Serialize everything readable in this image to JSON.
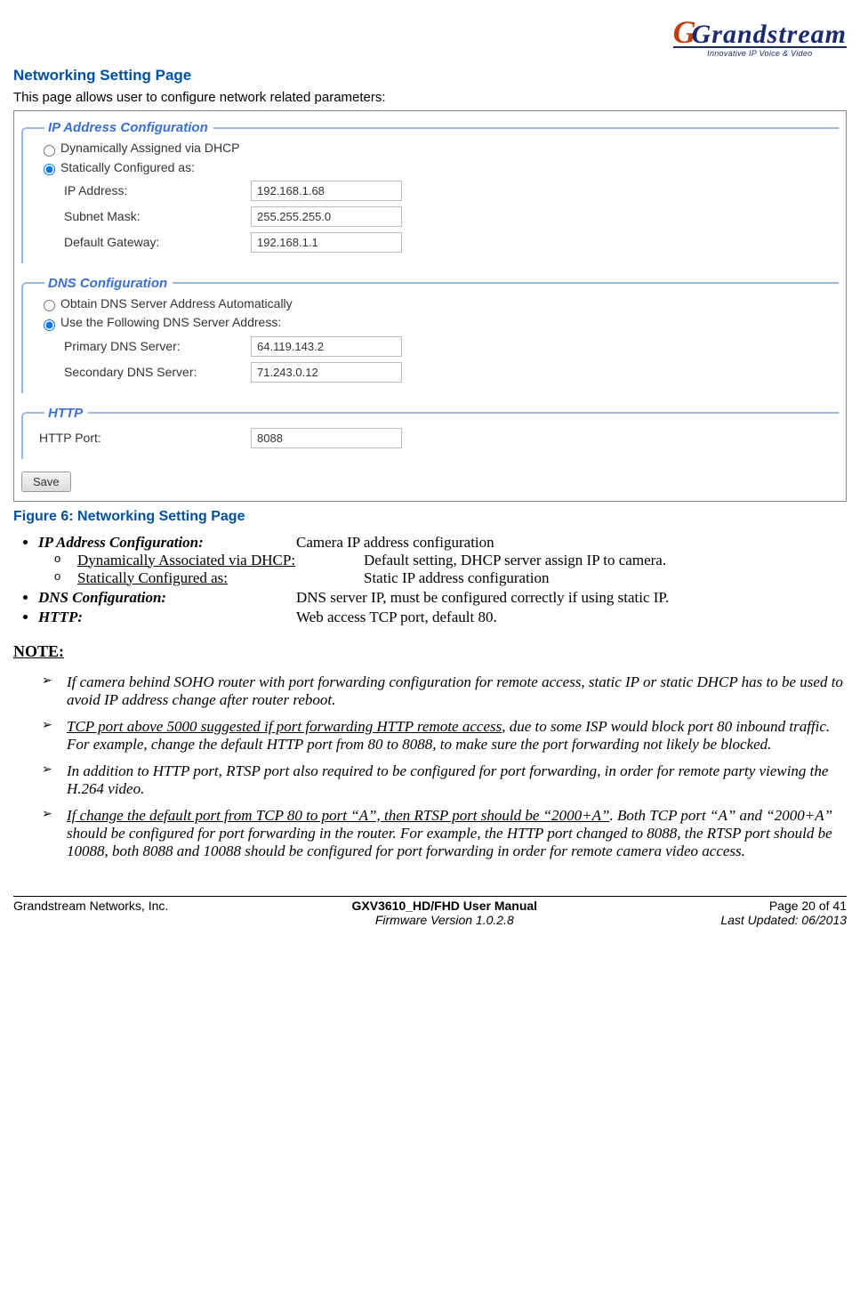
{
  "logo": {
    "main": "Grandstream",
    "sub": "Innovative IP Voice & Video"
  },
  "section": {
    "title": "Networking Setting Page",
    "intro": "This page allows user to configure network related parameters:"
  },
  "screenshot": {
    "ip": {
      "legend": "IP Address Configuration",
      "opt_dhcp": "Dynamically Assigned via DHCP",
      "opt_static": "Statically Configured as:",
      "ip_label": "IP Address:",
      "ip_value": "192.168.1.68",
      "mask_label": "Subnet Mask:",
      "mask_value": "255.255.255.0",
      "gw_label": "Default Gateway:",
      "gw_value": "192.168.1.1"
    },
    "dns": {
      "legend": "DNS Configuration",
      "opt_auto": "Obtain DNS Server Address Automatically",
      "opt_manual": "Use the Following DNS Server Address:",
      "primary_label": "Primary DNS Server:",
      "primary_value": "64.119.143.2",
      "secondary_label": "Secondary DNS Server:",
      "secondary_value": "71.243.0.12"
    },
    "http": {
      "legend": "HTTP",
      "port_label": "HTTP Port:",
      "port_value": "8088"
    },
    "save": "Save"
  },
  "figure_caption": "Figure 6:  Networking Setting Page",
  "config": {
    "ip_term": "IP Address Configuration:",
    "ip_desc": "Camera IP address configuration",
    "ip_sub1_label": "Dynamically Associated via DHCP:",
    "ip_sub1_desc": "Default setting, DHCP server assign IP to camera.",
    "ip_sub2_label": "Statically Configured as: ",
    "ip_sub2_desc": "Static IP address configuration",
    "dns_term": "DNS Configuration:",
    "dns_desc": "DNS server IP, must be configured correctly if using static IP.",
    "http_term": "HTTP:",
    "http_desc": "Web access TCP port, default 80."
  },
  "note": {
    "heading": "NOTE:",
    "n1": "If camera behind SOHO router with port forwarding configuration for remote access, static IP or static DHCP has to be used to avoid IP address change after router reboot.",
    "n2_u": "TCP port above 5000 suggested if port forwarding HTTP remote access",
    "n2_rest": ", due to some ISP would block port 80 inbound traffic. For example, change the default HTTP port from 80 to 8088, to make sure the port forwarding not likely be blocked.",
    "n3": " In addition to HTTP port, RTSP port also required to be configured for port forwarding, in order for remote party viewing the H.264 video.",
    "n4_u": "If change the default port from TCP 80 to port “A”, then RTSP port should be “2000+A”",
    "n4_rest": ". Both TCP port “A” and “2000+A” should be configured for port forwarding in the router. For example, the HTTP port changed to 8088, the RTSP port should be 10088, both 8088 and 10088 should be configured for port forwarding in order for remote camera video access."
  },
  "footer": {
    "left": "Grandstream Networks, Inc.",
    "center": "GXV3610_HD/FHD User Manual",
    "firmware": "Firmware Version 1.0.2.8",
    "page": "Page 20 of 41",
    "updated": "Last Updated: 06/2013"
  }
}
